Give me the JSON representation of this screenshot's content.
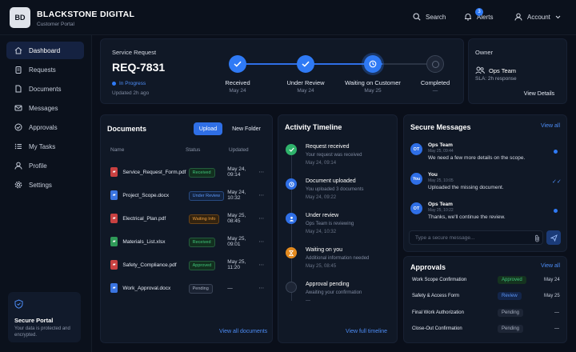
{
  "header": {
    "logo": "BD",
    "brand": "BLACKSTONE DIGITAL",
    "subtitle": "Customer Portal",
    "search": "Search",
    "alerts": "Alerts",
    "alerts_count": "3",
    "account": "Account"
  },
  "sidebar": {
    "items": [
      "Dashboard",
      "Requests",
      "Documents",
      "Messages",
      "Approvals",
      "My Tasks",
      "Profile",
      "Settings"
    ],
    "secure_title": "Secure Portal",
    "secure_text": "Your data is protected and encrypted."
  },
  "request": {
    "label": "Service Request",
    "id": "REQ-7831",
    "status": "In Progress",
    "updated": "Updated 2h ago",
    "steps": [
      {
        "label": "Received",
        "date": "May 24"
      },
      {
        "label": "Under Review",
        "date": "May 24"
      },
      {
        "label": "Waiting on Customer",
        "date": "May 25"
      },
      {
        "label": "Completed",
        "date": "—"
      }
    ]
  },
  "owner": {
    "label": "Owner",
    "name": "Ops Team",
    "sla": "SLA: 2h response",
    "details": "View Details"
  },
  "documents": {
    "title": "Documents",
    "upload": "Upload",
    "new_folder": "New Folder",
    "cols": [
      "Name",
      "Status",
      "Updated"
    ],
    "rows": [
      {
        "name": "Service_Request_Form.pdf",
        "status": "Received",
        "updated": "May 24, 09:14",
        "type": "pdf"
      },
      {
        "name": "Project_Scope.docx",
        "status": "Under Review",
        "updated": "May 24, 10:32",
        "type": "doc"
      },
      {
        "name": "Electrical_Plan.pdf",
        "status": "Waiting Info",
        "updated": "May 25, 08:45",
        "type": "pdf"
      },
      {
        "name": "Materials_List.xlsx",
        "status": "Received",
        "updated": "May 25, 09:01",
        "type": "xls"
      },
      {
        "name": "Safety_Compliance.pdf",
        "status": "Approved",
        "updated": "May 25, 11:20",
        "type": "pdf"
      },
      {
        "name": "Work_Approval.docx",
        "status": "Pending",
        "updated": "—",
        "type": "doc"
      }
    ],
    "view_all": "View all documents"
  },
  "timeline": {
    "title": "Activity Timeline",
    "items": [
      {
        "title": "Request received",
        "desc": "Your request was received",
        "time": "May 24, 09:14"
      },
      {
        "title": "Document uploaded",
        "desc": "You uploaded 3 documents",
        "time": "May 24, 09:22"
      },
      {
        "title": "Under review",
        "desc": "Ops Team is reviewing",
        "time": "May 24, 10:32"
      },
      {
        "title": "Waiting on you",
        "desc": "Additional information needed",
        "time": "May 25, 08:45"
      },
      {
        "title": "Approval pending",
        "desc": "Awaiting your confirmation",
        "time": "—"
      }
    ],
    "view_full": "View full timeline"
  },
  "messages": {
    "title": "Secure Messages",
    "view_all": "View all",
    "items": [
      {
        "avatar": "OT",
        "name": "Ops Team",
        "time": "May 25, 09:44",
        "text": "We need a few more details on the scope."
      },
      {
        "avatar": "You",
        "name": "You",
        "time": "May 25, 10:05",
        "text": "Uploaded the missing document."
      },
      {
        "avatar": "OT",
        "name": "Ops Team",
        "time": "May 25, 10:22",
        "text": "Thanks, we'll continue the review."
      }
    ],
    "placeholder": "Type a secure message..."
  },
  "approvals": {
    "title": "Approvals",
    "view_all": "View all",
    "items": [
      {
        "name": "Work Scope Confirmation",
        "status": "Approved",
        "date": "May 24"
      },
      {
        "name": "Safety & Access Form",
        "status": "Review",
        "date": "May 25"
      },
      {
        "name": "Final Work Authorization",
        "status": "Pending",
        "date": "—"
      },
      {
        "name": "Close-Out Confirmation",
        "status": "Pending",
        "date": "—"
      }
    ]
  },
  "colors": {
    "accent": "#2f7af5",
    "bg": "#0a0f1a",
    "card": "#101826",
    "green": "#2fb36b",
    "orange": "#e38a1f"
  }
}
